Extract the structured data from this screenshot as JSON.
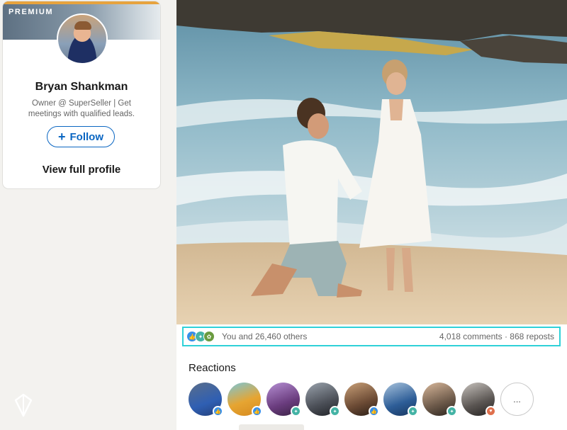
{
  "profile": {
    "premium_label": "PREMIUM",
    "name": "Bryan Shankman",
    "headline": "Owner @ SuperSeller | Get meetings with qualified leads.",
    "follow_label": "Follow",
    "view_profile_label": "View full profile",
    "accent_color": "#0a66c2"
  },
  "post": {
    "image_description_icon": "beach-proposal-photo",
    "engagement": {
      "reactions_text": "You and 26,460 others",
      "comments_reposts_text": "4,018 comments · 868 reposts",
      "reaction_icons": [
        "like-icon",
        "celebrate-icon",
        "support-icon"
      ]
    },
    "reactions": {
      "title": "Reactions",
      "people": [
        {
          "badge": "like",
          "badge_color": "#378fe9"
        },
        {
          "badge": "like",
          "badge_color": "#378fe9"
        },
        {
          "badge": "celebrate",
          "badge_color": "#44b3a5"
        },
        {
          "badge": "celebrate",
          "badge_color": "#44b3a5"
        },
        {
          "badge": "like",
          "badge_color": "#378fe9"
        },
        {
          "badge": "celebrate",
          "badge_color": "#44b3a5"
        },
        {
          "badge": "celebrate",
          "badge_color": "#44b3a5"
        },
        {
          "badge": "love",
          "badge_color": "#df704d"
        }
      ],
      "more_label": "..."
    }
  }
}
